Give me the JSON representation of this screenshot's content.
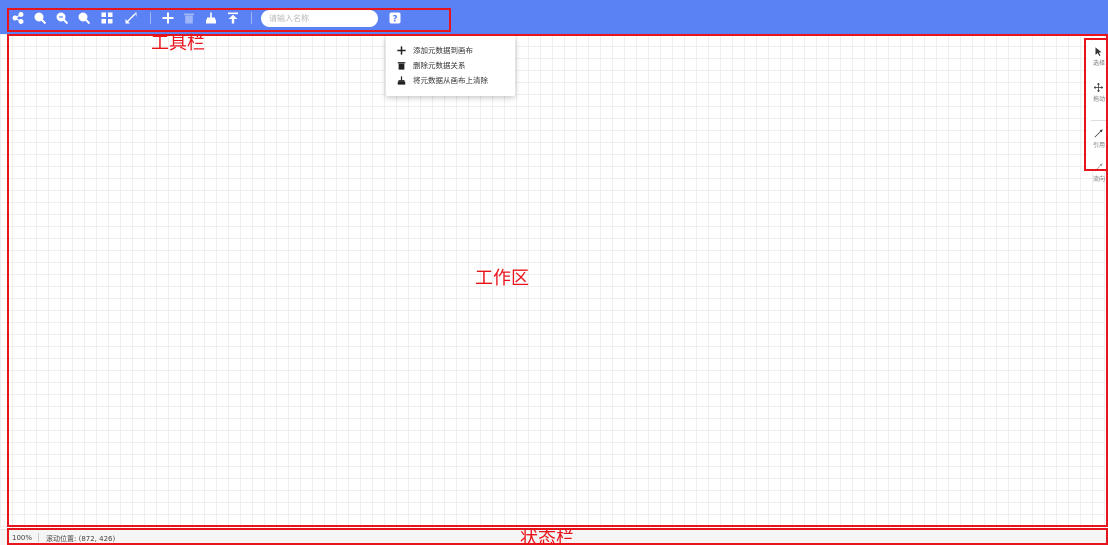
{
  "toolbar": {
    "search_placeholder": "请输入名称",
    "buttons": [
      {
        "icon": "share-icon"
      },
      {
        "icon": "zoom-in-icon"
      },
      {
        "icon": "zoom-out-icon"
      },
      {
        "icon": "zoom-reset-icon"
      },
      {
        "icon": "grid-layout-icon"
      },
      {
        "icon": "fullscreen-icon"
      },
      {
        "icon": "add-icon"
      },
      {
        "icon": "delete-icon",
        "disabled": true
      },
      {
        "icon": "clear-canvas-icon"
      },
      {
        "icon": "export-icon"
      },
      {
        "icon": "help-icon"
      }
    ],
    "accent_color": "#5b82f4"
  },
  "help_menu": {
    "items": [
      {
        "icon": "plus-icon",
        "label": "添加元数据到画布"
      },
      {
        "icon": "trash-icon",
        "label": "删除元数据关系"
      },
      {
        "icon": "broom-icon",
        "label": "将元数据从画布上清除"
      }
    ]
  },
  "right_tools": [
    {
      "icon": "pointer-icon",
      "label": "选择"
    },
    {
      "icon": "move-icon",
      "label": "拖动"
    },
    {
      "icon": "reference-arrow-icon",
      "label": "引用"
    },
    {
      "icon": "flow-arrow-icon",
      "label": "流向"
    }
  ],
  "status": {
    "zoom": "100%",
    "position": "滚动位置: (872, 426)"
  },
  "annotations": {
    "toolbar": "工具栏",
    "workspace": "工作区",
    "statusbar": "状态栏",
    "color": "#e8141b"
  }
}
